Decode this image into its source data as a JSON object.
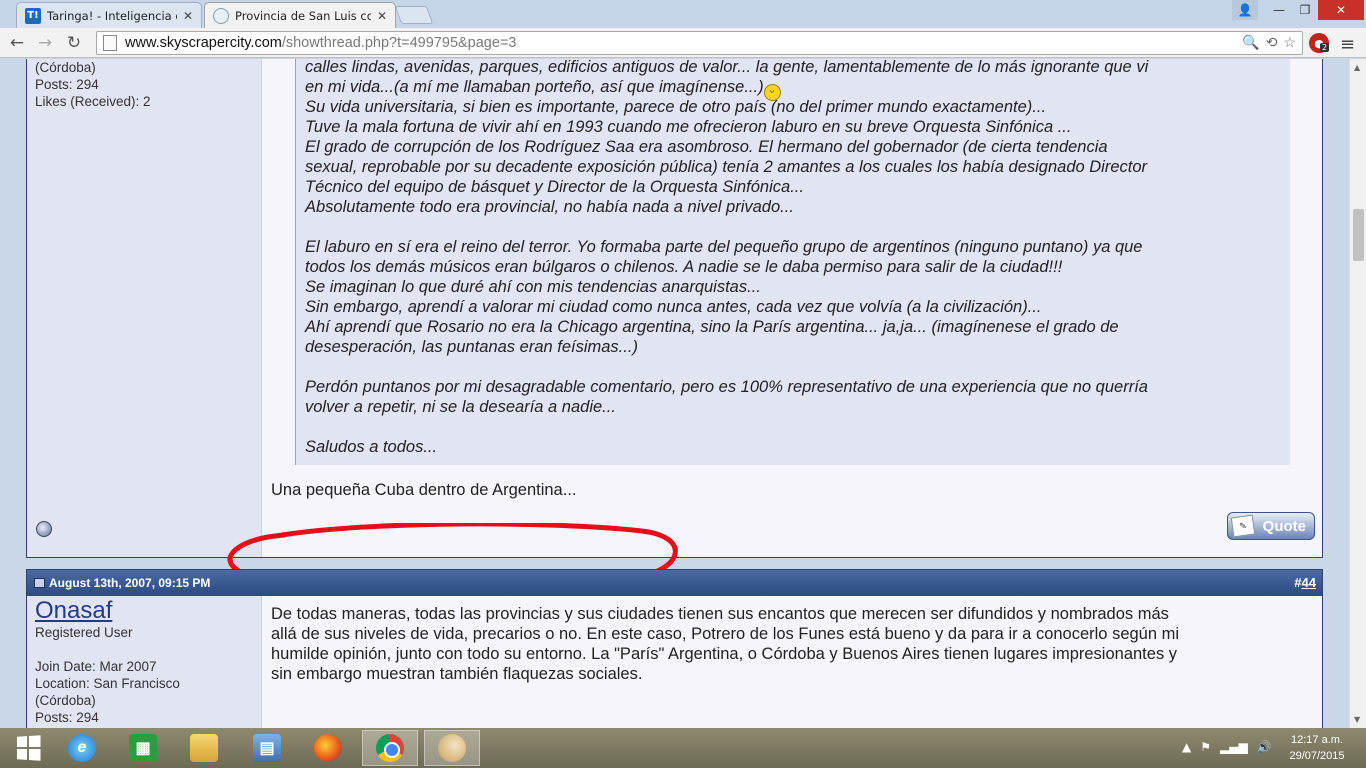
{
  "browser": {
    "tabs": [
      {
        "title": "Taringa! - Inteligencia col",
        "favicon": "taringa-icon",
        "active": false
      },
      {
        "title": "Provincia de San Luis com",
        "favicon": "skyscrapercity-icon",
        "active": true
      }
    ],
    "url_host": "www.skyscrapercity.com",
    "url_path": "/showthread.php?t=499795&page=3",
    "extension_badge": "2"
  },
  "post1": {
    "user_lines": [
      "(Córdoba)",
      "Posts: 294",
      "Likes (Received): 2"
    ],
    "quote_lines": [
      "calles lindas, avenidas, parques, edificios antiguos de valor... la gente, lamentablemente de lo más ignorante que vi",
      "en mi vida...(a mí me llamaban porteño, así que imagínense...)",
      "Su vida universitaria, si bien es importante, parece de otro país (no del primer mundo exactamente)...",
      "Tuve la mala fortuna de vivir ahí en 1993 cuando me ofrecieron laburo en su breve Orquesta Sinfónica ...",
      "El grado de corrupción de los Rodríguez Saa era asombroso. El hermano del gobernador (de cierta tendencia",
      "sexual, reprobable por su decadente exposición pública) tenía 2 amantes a los cuales los había designado Director",
      "Técnico del equipo de básquet y Director de la Orquesta Sinfónica...",
      "Absolutamente todo era provincial, no había nada a nivel privado...",
      "",
      "El laburo en sí era el reino del terror. Yo formaba parte del pequeño grupo de argentinos (ninguno puntano) ya que",
      "todos los demás músicos eran búlgaros o chilenos. A nadie se le daba permiso para salir de la ciudad!!!",
      "Se imaginan lo que duré ahí con mis tendencias anarquistas...",
      "Sin embargo, aprendí a valorar mi ciudad como nunca antes, cada vez que volvía (a la civilización)...",
      "Ahí aprendí que Rosario no era la Chicago argentina, sino la París argentina... ja,ja... (imagínenese el grado de",
      "desesperación, las puntanas eran feísimas...)",
      "",
      "Perdón puntanos por mi desagradable comentario, pero es 100% representativo de una experiencia que no querría",
      "volver a repetir, ni se la desearía a nadie...",
      "",
      "Saludos a todos..."
    ],
    "reply": "Una pequeña Cuba dentro de Argentina...",
    "quote_button": "Quote"
  },
  "post2": {
    "date": "August 13th, 2007, 09:15 PM",
    "number_prefix": "#",
    "number": "44",
    "username": "Onasaf",
    "user_lines": [
      "Registered User",
      "",
      "Join Date: Mar 2007",
      "Location: San Francisco",
      "(Córdoba)",
      "Posts: 294"
    ],
    "body_lines": [
      "De todas maneras, todas las provincias y sus ciudades tienen sus encantos que merecen ser difundidos y nombrados más",
      "allá de sus niveles de vida, precarios o no. En este caso, Potrero de los Funes está bueno y da para ir a conocerlo según mi",
      "humilde opinión, junto con todo su entorno. La \"París\" Argentina, o Córdoba y Buenos Aires tienen lugares impresionantes y",
      "sin embargo muestran también flaquezas sociales."
    ]
  },
  "annotation": {
    "color": "#e3101a"
  },
  "taskbar": {
    "apps": [
      "start-icon",
      "internet-explorer-icon",
      "store-icon",
      "file-explorer-icon",
      "control-panel-icon",
      "firefox-icon",
      "chrome-icon",
      "paint-icon"
    ],
    "time": "12:17 a.m.",
    "date": "29/07/2015"
  }
}
